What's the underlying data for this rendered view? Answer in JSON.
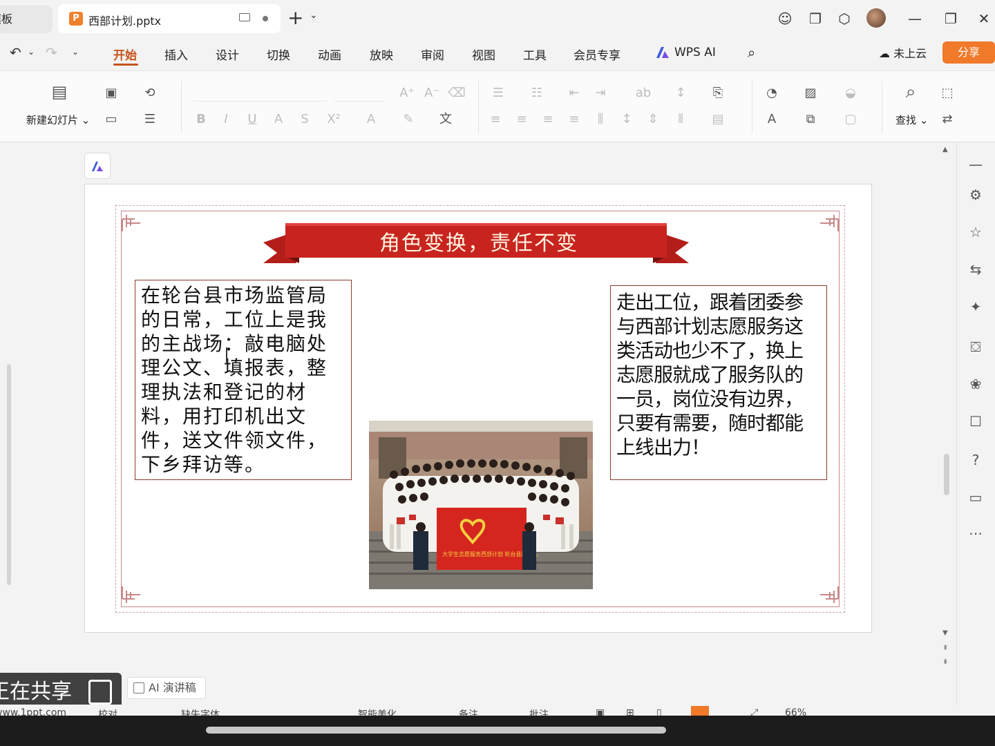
{
  "titlebar": {
    "templates_tab": "模板",
    "doc_tab": "西部计划.pptx",
    "ppt_badge": "P",
    "new_tab": "+"
  },
  "menu": {
    "items": [
      "开始",
      "插入",
      "设计",
      "切换",
      "动画",
      "放映",
      "审阅",
      "视图",
      "工具",
      "会员专享"
    ],
    "active": "开始",
    "wps_ai": "WPS AI",
    "cloud": "未上云",
    "share": "分享"
  },
  "ribbon": {
    "new_slide": "新建幻灯片",
    "find": "查找"
  },
  "slide": {
    "title": "角色变换，责任不变",
    "left_text": "在轮台县市场监管局的日常，工位上是我的主战场：敲电脑处理公文、填报表，整理执法和登记的材料，用打印机出文件，送文件领文件，下乡拜访等。",
    "right_text": "走出工位，跟着团委参与西部计划志愿服务这类活动也少不了，换上志愿服就成了服务队的一员，岗位没有边界，只要有需要，随时都能上线出力！",
    "flag_text": "大学生志愿服务西部计划 轮台县服务队"
  },
  "bottom": {
    "sharing_label": "正在共享",
    "ai_notes": "AI 演讲稿",
    "status_items": [
      "www.1ppt.com",
      "校对",
      "缺失字体",
      "智能美化",
      "备注",
      "批注",
      "66%"
    ]
  },
  "colors": {
    "accent": "#c5521a",
    "share_button": "#f07a2a",
    "banner_red": "#c8241f",
    "frame": "#c98787"
  }
}
